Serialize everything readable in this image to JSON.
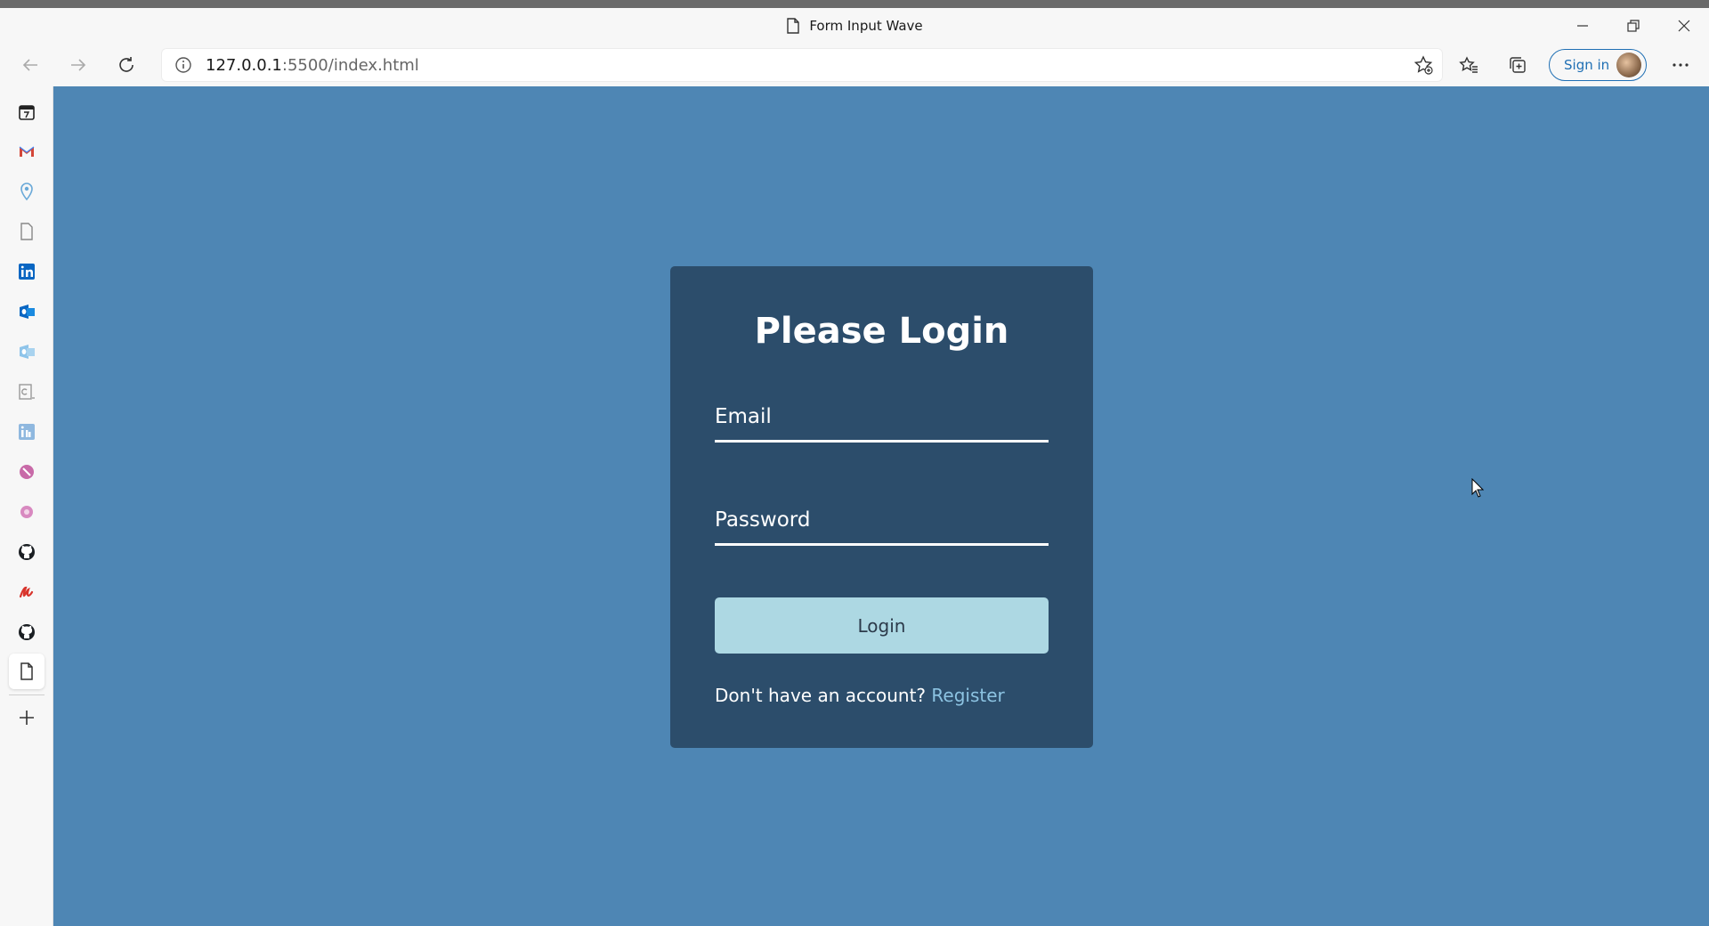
{
  "browser": {
    "tab_title": "Form Input Wave",
    "url_host": "127.0.0.1",
    "url_rest": ":5500/index.html",
    "signin_label": "Sign in"
  },
  "login_card": {
    "title": "Please Login",
    "email_label": "Email",
    "password_label": "Password",
    "login_button": "Login",
    "register_prompt": "Don't have an account?",
    "register_link": "Register"
  },
  "colors": {
    "page_bg": "#4e86b4",
    "card_bg": "#2c4d6b",
    "button_bg": "#add8e3",
    "link": "#8cc3e2"
  },
  "sidebar_icons": [
    "calendar-icon",
    "gmail-icon",
    "location-pin-icon",
    "page-icon",
    "linkedin-icon",
    "outlook-icon",
    "outlook-light-icon",
    "document-c-icon",
    "linkedin-light-icon",
    "pink-circle-icon",
    "pink-dot-icon",
    "github-icon",
    "red-logo-icon",
    "github-icon-2",
    "active-page-icon",
    "add-icon"
  ]
}
